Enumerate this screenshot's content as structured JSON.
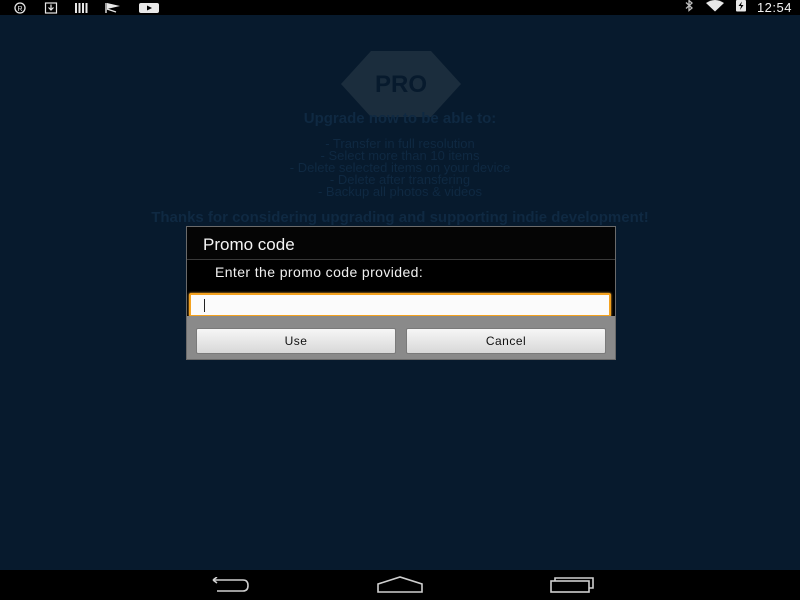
{
  "status_bar": {
    "time": "12:54",
    "left_icons": [
      "registered-icon",
      "download-icon",
      "bars-icon",
      "flag-icon",
      "youtube-icon"
    ],
    "right_icons": [
      "bluetooth-icon",
      "wifi-icon",
      "battery-charging-icon"
    ]
  },
  "background": {
    "badge": "PRO",
    "heading": "Upgrade now to be able to:",
    "features": [
      "- Transfer in full resolution",
      "- Select more than 10 items",
      "- Delete selected items on your device",
      "- Delete after transfering",
      "- Backup all photos & videos"
    ],
    "thanks": "Thanks for considering upgrading and supporting indie development!"
  },
  "dialog": {
    "title": "Promo code",
    "message": "Enter the promo code provided:",
    "input_value": "",
    "use_label": "Use",
    "cancel_label": "Cancel"
  },
  "nav_bar": {
    "buttons": [
      "back-icon",
      "home-icon",
      "recents-icon"
    ]
  },
  "colors": {
    "background": "#071a2d",
    "dialog_title_bg": "#050505",
    "input_focus": "#f4a21f",
    "button_bar": "#8a8a8a"
  }
}
